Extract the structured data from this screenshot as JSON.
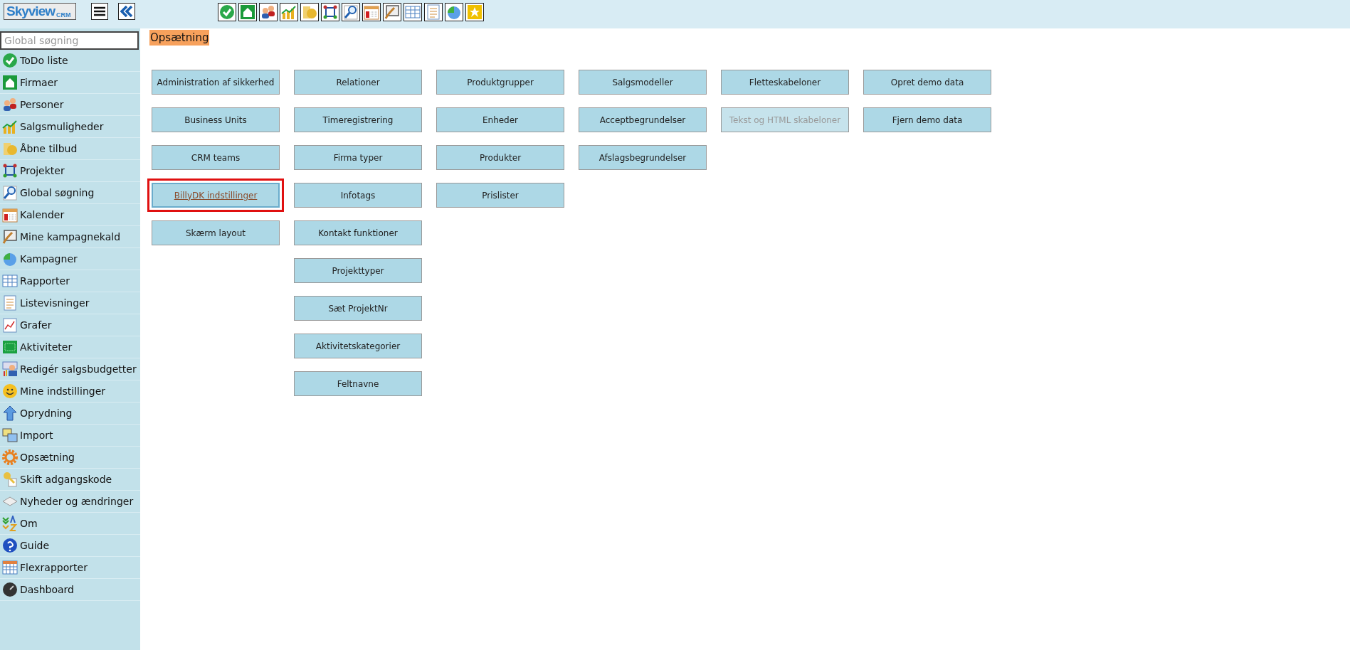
{
  "logo": {
    "name": "Skyview",
    "suffix": "CRM"
  },
  "search": {
    "placeholder": "Global søgning"
  },
  "sidebar": {
    "items": [
      {
        "label": "ToDo liste"
      },
      {
        "label": "Firmaer"
      },
      {
        "label": "Personer"
      },
      {
        "label": "Salgsmuligheder"
      },
      {
        "label": "Åbne tilbud"
      },
      {
        "label": "Projekter"
      },
      {
        "label": "Global søgning"
      },
      {
        "label": "Kalender"
      },
      {
        "label": "Mine kampagnekald"
      },
      {
        "label": "Kampagner"
      },
      {
        "label": "Rapporter"
      },
      {
        "label": "Listevisninger"
      },
      {
        "label": "Grafer"
      },
      {
        "label": "Aktiviteter"
      },
      {
        "label": "Redigér salgsbudgetter"
      },
      {
        "label": "Mine indstillinger"
      },
      {
        "label": "Oprydning"
      },
      {
        "label": "Import"
      },
      {
        "label": "Opsætning"
      },
      {
        "label": "Skift adgangskode"
      },
      {
        "label": "Nyheder og ændringer"
      },
      {
        "label": "Om"
      },
      {
        "label": "Guide"
      },
      {
        "label": "Flexrapporter"
      },
      {
        "label": "Dashboard"
      }
    ]
  },
  "page_title": "Opsætning",
  "columns": [
    [
      {
        "label": "Administration af sikkerhed",
        "disabled": false,
        "focused": false
      },
      {
        "label": "Business Units",
        "disabled": false,
        "focused": false
      },
      {
        "label": "CRM teams",
        "disabled": false,
        "focused": false
      },
      {
        "label": "BillyDK indstillinger",
        "disabled": false,
        "focused": true
      },
      {
        "label": "Skærm layout",
        "disabled": false,
        "focused": false
      }
    ],
    [
      {
        "label": "Relationer",
        "disabled": false,
        "focused": false
      },
      {
        "label": "Timeregistrering",
        "disabled": false,
        "focused": false
      },
      {
        "label": "Firma typer",
        "disabled": false,
        "focused": false
      },
      {
        "label": "Infotags",
        "disabled": false,
        "focused": false
      },
      {
        "label": "Kontakt funktioner",
        "disabled": false,
        "focused": false
      },
      {
        "label": "Projekttyper",
        "disabled": false,
        "focused": false
      },
      {
        "label": "Sæt ProjektNr",
        "disabled": false,
        "focused": false
      },
      {
        "label": "Aktivitetskategorier",
        "disabled": false,
        "focused": false
      },
      {
        "label": "Feltnavne",
        "disabled": false,
        "focused": false
      }
    ],
    [
      {
        "label": "Produktgrupper",
        "disabled": false,
        "focused": false
      },
      {
        "label": "Enheder",
        "disabled": false,
        "focused": false
      },
      {
        "label": "Produkter",
        "disabled": false,
        "focused": false
      },
      {
        "label": "Prislister",
        "disabled": false,
        "focused": false
      }
    ],
    [
      {
        "label": "Salgsmodeller",
        "disabled": false,
        "focused": false
      },
      {
        "label": "Acceptbegrundelser",
        "disabled": false,
        "focused": false
      },
      {
        "label": "Afslagsbegrundelser",
        "disabled": false,
        "focused": false
      }
    ],
    [
      {
        "label": "Fletteskabeloner",
        "disabled": false,
        "focused": false
      },
      {
        "label": "Tekst og HTML skabeloner",
        "disabled": true,
        "focused": false
      }
    ],
    [
      {
        "label": "Opret demo data",
        "disabled": false,
        "focused": false
      },
      {
        "label": "Fjern demo data",
        "disabled": false,
        "focused": false
      }
    ]
  ]
}
